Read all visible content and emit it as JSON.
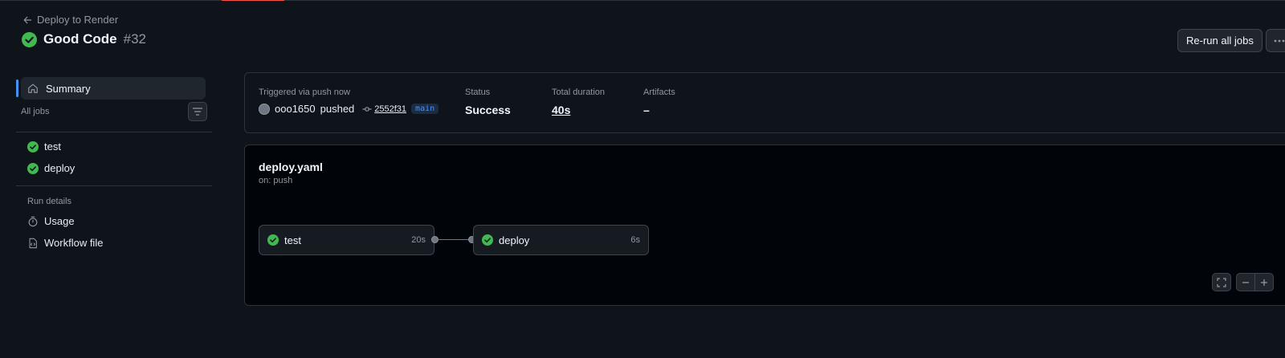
{
  "header": {
    "back_label": "Deploy to Render",
    "run_name": "Good Code",
    "run_number": "#32",
    "rerun_label": "Re-run all jobs",
    "more_label": "···"
  },
  "sidebar": {
    "summary_label": "Summary",
    "all_jobs_label": "All jobs",
    "jobs": [
      {
        "label": "test",
        "status": "success"
      },
      {
        "label": "deploy",
        "status": "success"
      }
    ],
    "run_details_label": "Run details",
    "details": [
      {
        "label": "Usage",
        "icon": "stopwatch-icon"
      },
      {
        "label": "Workflow file",
        "icon": "file-code-icon"
      }
    ]
  },
  "summary": {
    "trigger_label": "Triggered via push now",
    "actor": "ooo1650",
    "action": "pushed",
    "commit": "2552f31",
    "branch": "main",
    "status_label": "Status",
    "status_value": "Success",
    "duration_label": "Total duration",
    "duration_value": "40s",
    "artifacts_label": "Artifacts",
    "artifacts_value": "–"
  },
  "workflow": {
    "file": "deploy.yaml",
    "trigger": "on: push",
    "jobs": [
      {
        "name": "test",
        "duration": "20s",
        "status": "success"
      },
      {
        "name": "deploy",
        "duration": "6s",
        "status": "success"
      }
    ]
  },
  "colors": {
    "success": "#3fb950",
    "accent": "#4493f8",
    "background": "#0f141b",
    "panel": "#010409"
  }
}
